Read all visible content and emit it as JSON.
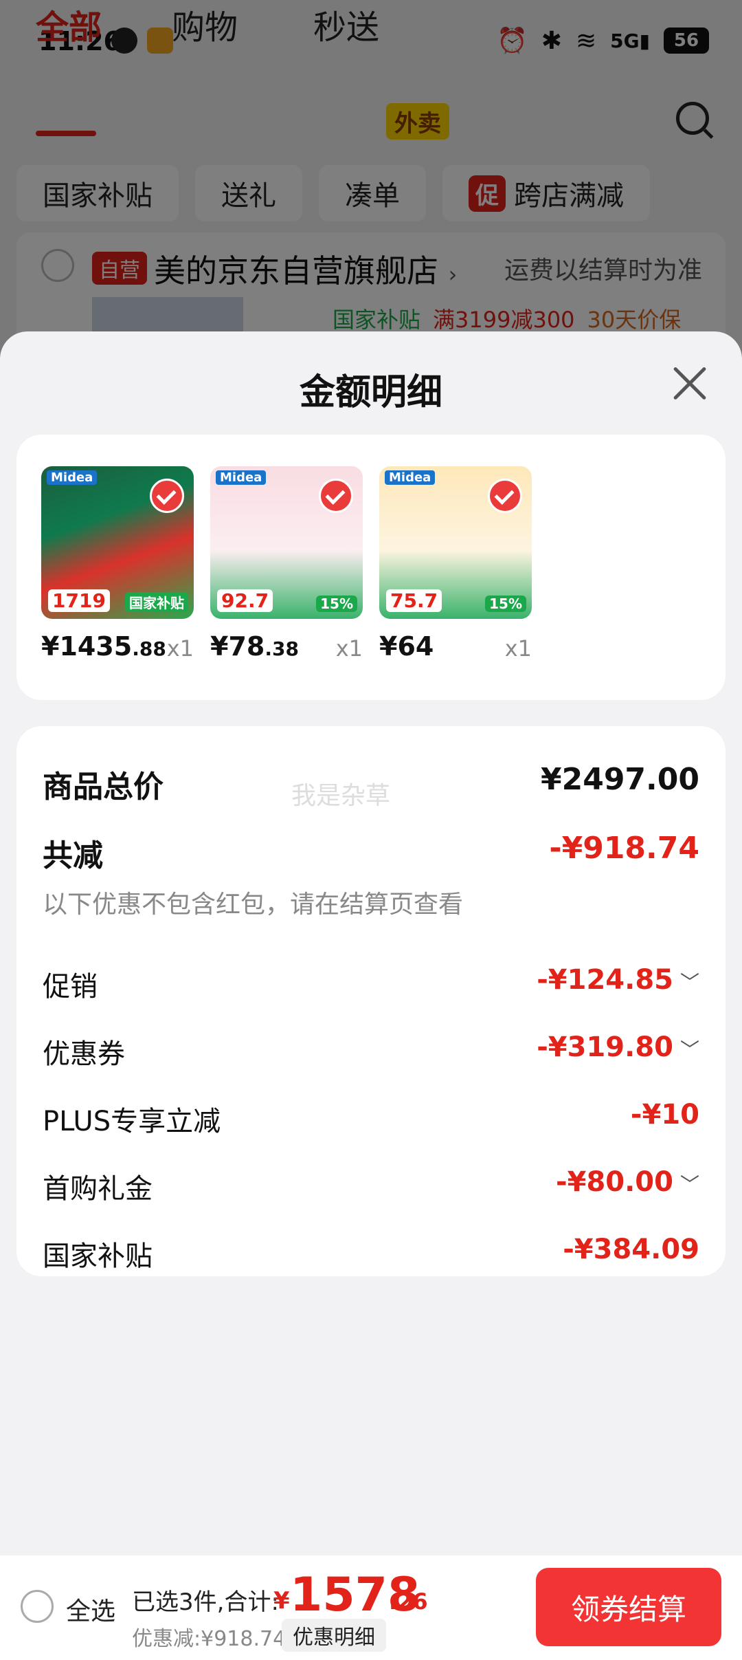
{
  "status_bar": {
    "time": "11:26",
    "battery": "56",
    "network": "5G",
    "icons": [
      "wechat-icon",
      "app-notification-icon",
      "alarm-icon",
      "bluetooth-icon",
      "wifi-icon",
      "signal-icon",
      "battery-icon"
    ]
  },
  "background": {
    "tabs": [
      "全部",
      "购物",
      "秒送"
    ],
    "active_tab": "全部",
    "takeout_badge": "外卖",
    "filters": [
      "国家补贴",
      "送礼",
      "凑单"
    ],
    "promo_filter": {
      "tag": "促",
      "label": "跨店满减"
    },
    "store": {
      "tag": "自营",
      "name": "美的京东自营旗舰店",
      "chevron": "›",
      "shipping_note": "运费以结算时为准",
      "promos": [
        "国家补贴",
        "满3199减300",
        "30天价保"
      ]
    }
  },
  "sheet": {
    "title": "金额明细",
    "products": [
      {
        "price_int": "¥1435",
        "price_dec": ".88",
        "qty": "x1",
        "brand": "Midea",
        "img_price": "1719",
        "img_tag": "国家补贴"
      },
      {
        "price_int": "¥78",
        "price_dec": ".38",
        "qty": "x1",
        "brand": "Midea",
        "img_price": "92.7",
        "img_tag": "15%"
      },
      {
        "price_int": "¥64",
        "price_dec": "",
        "qty": "x1",
        "brand": "Midea",
        "img_price": "75.7",
        "img_tag": "15%"
      }
    ],
    "summary": {
      "watermark": "我是杂草",
      "total_label": "商品总价",
      "total_amount": "¥2497.00",
      "discount_label": "共减",
      "discount_amount": "-¥918.74",
      "note": "以下优惠不包含红包，请在结算页查看",
      "items": [
        {
          "label": "促销",
          "amount": "-¥124.85",
          "chevron": "﹀"
        },
        {
          "label": "优惠券",
          "amount": "-¥319.80",
          "chevron": "﹀"
        },
        {
          "label": "PLUS专享立减",
          "amount": "-¥10",
          "chevron": ""
        },
        {
          "label": "首购礼金",
          "amount": "-¥80.00",
          "chevron": "﹀"
        },
        {
          "label": "国家补贴",
          "amount": "-¥384.09",
          "chevron": ""
        }
      ]
    }
  },
  "bottom_bar": {
    "select_all": "全选",
    "selected_text": "已选3件,合计:",
    "currency": "¥",
    "total_int": "1578",
    "total_dec": ".26",
    "discount_text": "优惠减:¥918.74",
    "detail_button": "优惠明细",
    "checkout_button": "领券结算"
  },
  "colors": {
    "accent": "#e2231a",
    "checkout": "#f33434",
    "green": "#1ba84a"
  }
}
